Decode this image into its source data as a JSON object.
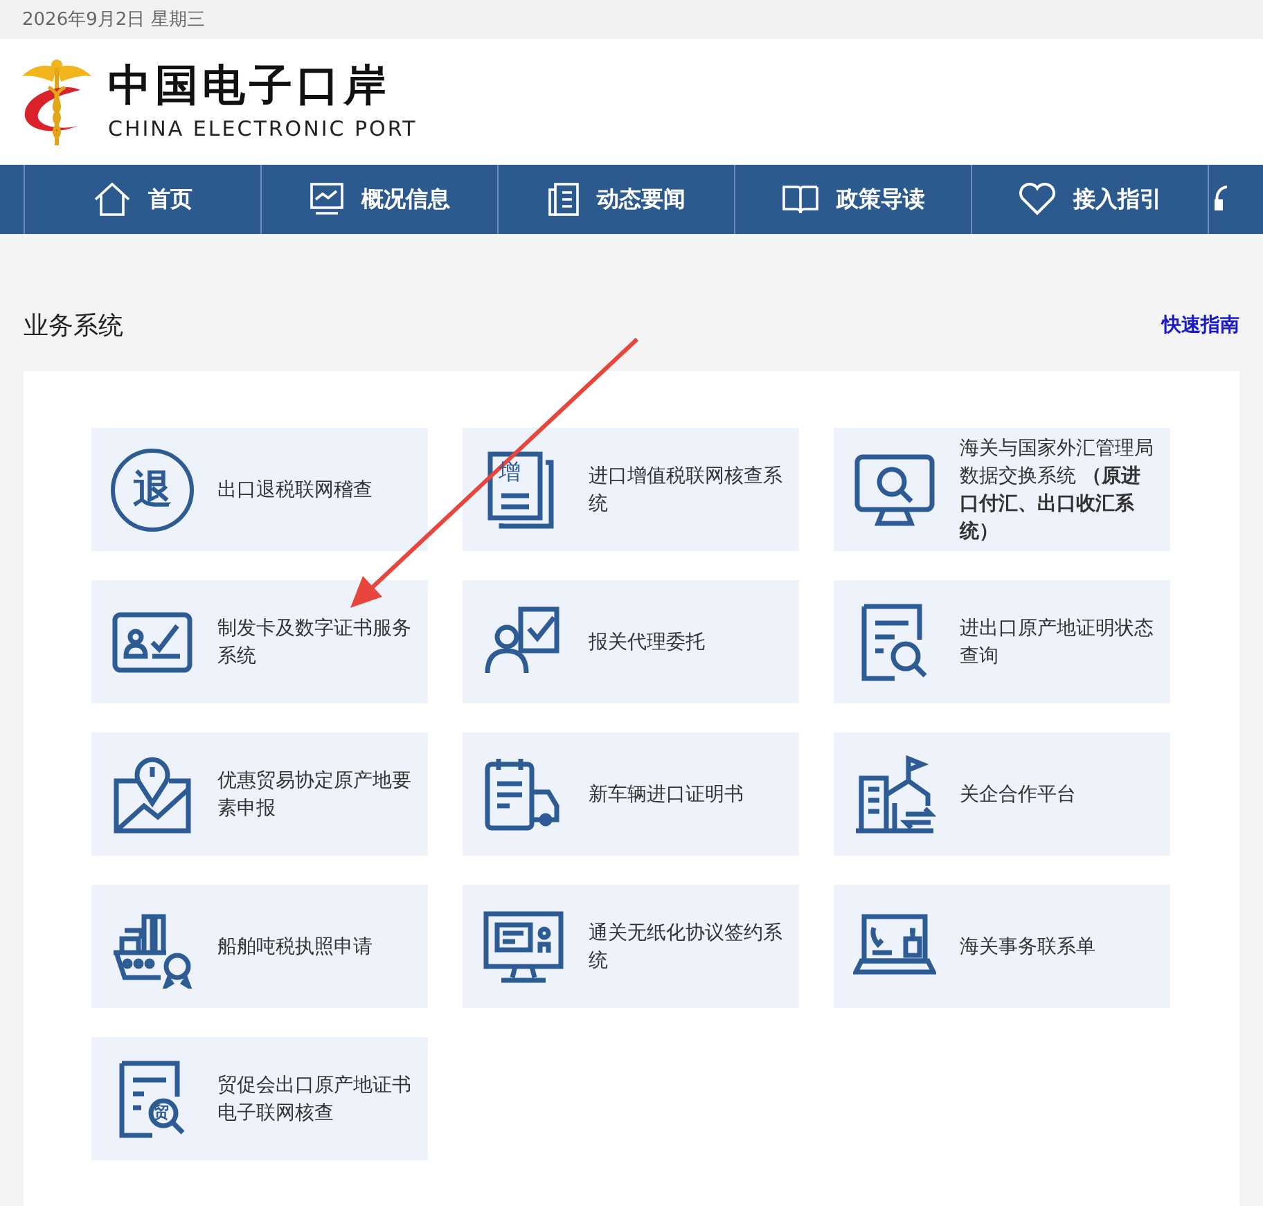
{
  "date_bar": {
    "text": "2026年9月2日 星期三"
  },
  "header": {
    "logo_title": "中国电子口岸",
    "logo_subtitle": "CHINA ELECTRONIC PORT"
  },
  "nav": [
    {
      "kind": "home",
      "label": "首页"
    },
    {
      "kind": "monitor",
      "label": "概况信息"
    },
    {
      "kind": "document",
      "label": "动态要闻"
    },
    {
      "kind": "book",
      "label": "政策导读"
    },
    {
      "kind": "heart",
      "label": "接入指引"
    },
    {
      "kind": "headset"
    }
  ],
  "section": {
    "title": "业务系统",
    "link": "快速指南"
  },
  "tiles": [
    {
      "kind": "circle-char",
      "glyph": "退",
      "label": "出口退税联网稽查"
    },
    {
      "kind": "doc-char",
      "glyph": "增",
      "label": "进口增值税联网核查系统"
    },
    {
      "kind": "monitor-search",
      "label": "海关与国家外汇管理局数据交换系统 **（原进口付汇、出口收汇系统）**"
    },
    {
      "kind": "id-card",
      "label": "制发卡及数字证书服务系统"
    },
    {
      "kind": "person-clipboard",
      "label": "报关代理委托"
    },
    {
      "kind": "doc-search",
      "label": "进出口原产地证明状态查询"
    },
    {
      "kind": "map-pin",
      "label": "优惠贸易协定原产地要素申报"
    },
    {
      "kind": "truck-doc",
      "label": "新车辆进口证明书"
    },
    {
      "kind": "buildings",
      "label": "关企合作平台"
    },
    {
      "kind": "ship",
      "label": "船舶吨税执照申请"
    },
    {
      "kind": "monitor-card",
      "label": "通关无纸化协议签约系统"
    },
    {
      "kind": "laptop",
      "label": "海关事务联系单"
    },
    {
      "kind": "doc-search-char",
      "glyph": "贸",
      "label": "贸促会出口原产地证书电子联网核查"
    }
  ]
}
